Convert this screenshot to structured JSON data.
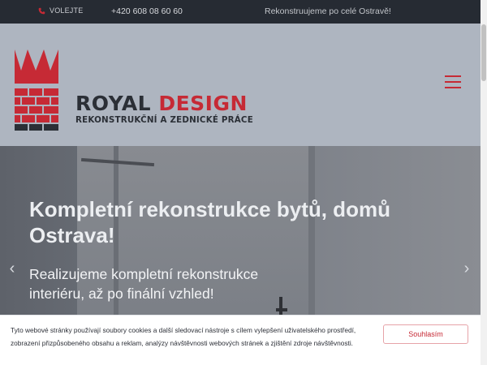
{
  "topbar": {
    "call_label": "VOLEJTE",
    "phone": "+420 608 08 60 60",
    "tagline": "Rekonstruujeme po celé Ostravě!"
  },
  "logo": {
    "word1": "ROYAL",
    "word2": "DESIGN",
    "subtitle": "REKONSTRUKČNÍ A ZEDNICKÉ PRÁCE"
  },
  "hero": {
    "title": "Kompletní rekonstrukce bytů, domů Ostrava!",
    "text": "Realizujeme kompletní rekonstrukce interiéru, až po finální vzhled!"
  },
  "cookie": {
    "text": "Tyto webové stránky používají soubory cookies a další sledovací nástroje s cílem vylepšení uživatelského prostředí, zobrazení přizpůsobeného obsahu a reklam, analýzy návštěvnosti webových stránek a zjištění zdroje návštěvnosti.",
    "accept_label": "Souhlasím"
  },
  "colors": {
    "brand_red": "#c62a35",
    "topbar_bg": "#262b33"
  },
  "icons": {
    "call": "phone-icon",
    "menu": "hamburger-icon",
    "prev": "chevron-left-icon",
    "next": "chevron-right-icon"
  }
}
